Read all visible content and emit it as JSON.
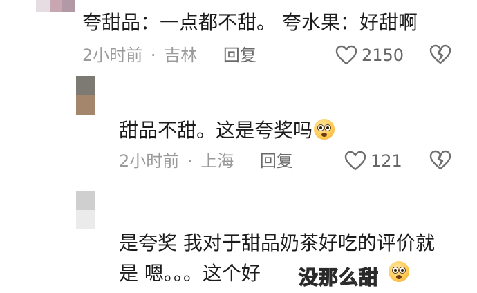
{
  "comments": [
    {
      "text": "夸甜品：一点都不甜。 夸水果：好甜啊",
      "time": "2小时前",
      "location": "吉林",
      "reply": "回复",
      "likes": "2150"
    },
    {
      "text": "甜品不甜。这是夸奖吗",
      "time": "2小时前",
      "location": "上海",
      "reply": "回复",
      "likes": "121"
    },
    {
      "text_line1": "是夸奖 我对于甜品奶茶好吃的评价就",
      "text_line2": "是 嗯。。。这个好"
    }
  ],
  "watermark": "没那么甜",
  "separator": "·",
  "icons": {
    "like": "heart-outline-icon",
    "dislike": "broken-heart-icon",
    "emoji": "flushed-face-emoji"
  }
}
